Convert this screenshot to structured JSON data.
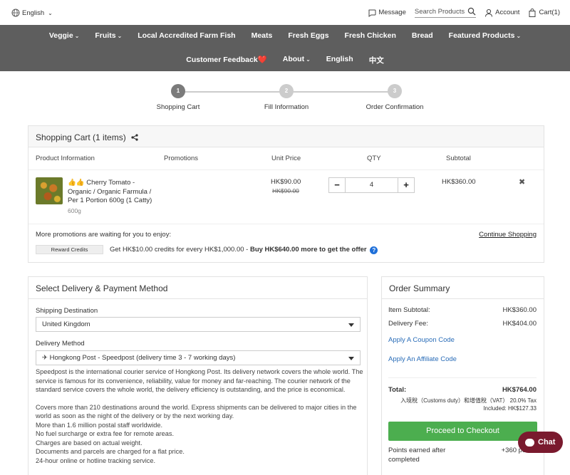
{
  "topbar": {
    "language": "English",
    "message": "Message",
    "search_placeholder": "Search Products",
    "account": "Account",
    "cart": "Cart(1)"
  },
  "nav": {
    "row1": [
      "Veggie",
      "Fruits",
      "Local Accredited Farm Fish",
      "Meats",
      "Fresh Eggs",
      "Fresh Chicken",
      "Bread",
      "Featured Products"
    ],
    "row1_caret": [
      true,
      true,
      false,
      false,
      false,
      false,
      false,
      true
    ],
    "row2": [
      "Customer Feedback❤️",
      "About",
      "English",
      "中文"
    ]
  },
  "steps": [
    {
      "num": "1",
      "label": "Shopping Cart"
    },
    {
      "num": "2",
      "label": "Fill Information"
    },
    {
      "num": "3",
      "label": "Order Confirmation"
    }
  ],
  "cart": {
    "title": "Shopping Cart  (1 items)",
    "columns": {
      "product": "Product Information",
      "promotions": "Promotions",
      "unit_price": "Unit Price",
      "qty": "QTY",
      "subtotal": "Subtotal"
    },
    "item": {
      "name": "👍👍 Cherry Tomato - Organic / Organic Farmula / Per 1 Portion 600g (1 Catty)",
      "weight": "600g",
      "price": "HK$90.00",
      "old_price": "HK$90.00",
      "qty": "4",
      "subtotal": "HK$360.00"
    },
    "more_promos": "More promotions are waiting for you to enjoy:",
    "continue": "Continue Shopping",
    "reward_tag": "Reward Credits",
    "offer_text": "Get HK$10.00 credits for every HK$1,000.00 - ",
    "offer_bold": "Buy HK$640.00 more to get the offer"
  },
  "delivery": {
    "title": "Select Delivery & Payment Method",
    "shipping_label": "Shipping Destination",
    "shipping_value": "United Kingdom",
    "method_label": "Delivery Method",
    "method_value": "✈ Hongkong Post - Speedpost (delivery time 3 - 7 working days)",
    "desc1": "Speedpost is the international courier service of Hongkong Post. Its delivery network covers the whole world. The service is famous for its convenience, reliability, value for money and far-reaching. The courier network of the standard service covers the whole world, the delivery efficiency is outstanding, and the price is economical.",
    "desc_lines": [
      "Covers more than 210 destinations around the world. Express shipments can be delivered to major cities in the world as soon as the night of the delivery or by the next working day.",
      "More than 1.6 million postal staff worldwide.",
      "No fuel surcharge or extra fee for remote areas.",
      "Charges are based on actual weight.",
      "Documents and parcels are charged for a flat price.",
      "24-hour online or hotline tracking service."
    ]
  },
  "summary": {
    "title": "Order Summary",
    "item_subtotal_label": "Item Subtotal:",
    "item_subtotal": "HK$360.00",
    "delivery_fee_label": "Delivery Fee:",
    "delivery_fee": "HK$404.00",
    "coupon": "Apply A Coupon Code",
    "affiliate": "Apply An Affiliate Code",
    "total_label": "Total:",
    "total": "HK$764.00",
    "tax_line": "入境稅（Customs duty）和增值稅（VAT） 20.0% Tax",
    "tax_included": "Included: HK$127.33",
    "checkout": "Proceed to Checkout",
    "points_label": "Points earned after completed",
    "points_value": "+360 points"
  },
  "chat": {
    "label": "Chat"
  },
  "colors": {
    "nav_bg": "#5e5e5e",
    "checkout": "#4cae4f",
    "link": "#2a6db8",
    "chat": "#7a1a2e"
  }
}
